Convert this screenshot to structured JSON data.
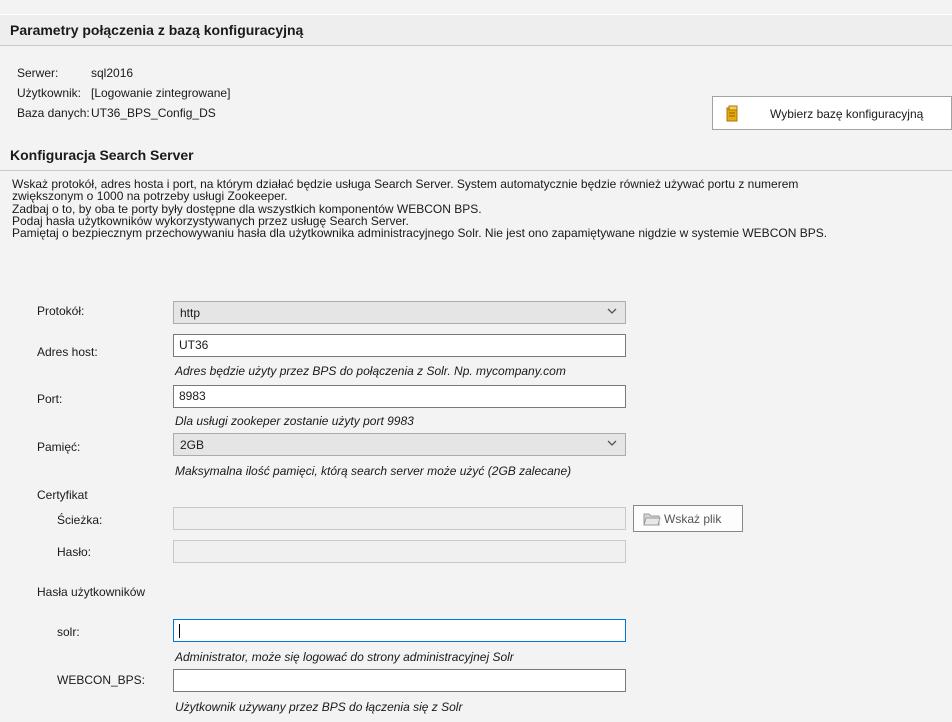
{
  "conn": {
    "title": "Parametry połączenia z bazą konfiguracyjną",
    "server_label": "Serwer:",
    "server_value": "sql2016",
    "user_label": "Użytkownik:",
    "user_value": "[Logowanie zintegrowane]",
    "db_label": "Baza danych:",
    "db_value": "UT36_BPS_Config_DS",
    "choose_db_button": "Wybierz bazę konfiguracyjną"
  },
  "search": {
    "title": "Konfiguracja Search Server",
    "desc": [
      "Wskaż protokół, adres hosta i port, na którym działać będzie usługa Search Server. System automatycznie będzie również używać portu z numerem",
      "zwiększonym o 1000 na potrzeby usługi Zookeeper.",
      "Zadbaj o to, by oba te porty były dostępne dla wszystkich komponentów WEBCON BPS.",
      "Podaj hasła użytkowników wykorzystywanych przez usługę Search Server.",
      "Pamiętaj o bezpiecznym przechowywaniu hasła dla użytkownika administracyjnego Solr. Nie jest ono zapamiętywane nigdzie w systemie WEBCON BPS."
    ]
  },
  "form": {
    "protocol_label": "Protokół:",
    "protocol_value": "http",
    "host_label": "Adres host:",
    "host_value": "UT36",
    "host_hint": "Adres będzie użyty przez BPS do połączenia z Solr. Np. mycompany.com",
    "port_label": "Port:",
    "port_value": "8983",
    "port_hint": "Dla usługi zookeper zostanie użyty port 9983",
    "memory_label": "Pamięć:",
    "memory_value": "2GB",
    "memory_hint": "Maksymalna ilość pamięci, którą search server może użyć (2GB zalecane)",
    "cert_label": "Certyfikat",
    "path_label": "Ścieżka:",
    "path_value": "",
    "browse_button": "Wskaż plik",
    "cert_password_label": "Hasło:",
    "cert_password_value": "",
    "passwords_label": "Hasła użytkowników",
    "solr_label": "solr:",
    "solr_value": "",
    "solr_hint": "Administrator, może się logować do strony administracyjnej Solr",
    "webcon_label": "WEBCON_BPS:",
    "webcon_value": "",
    "webcon_hint": "Użytkownik używany przez BPS do łączenia się z Solr"
  }
}
